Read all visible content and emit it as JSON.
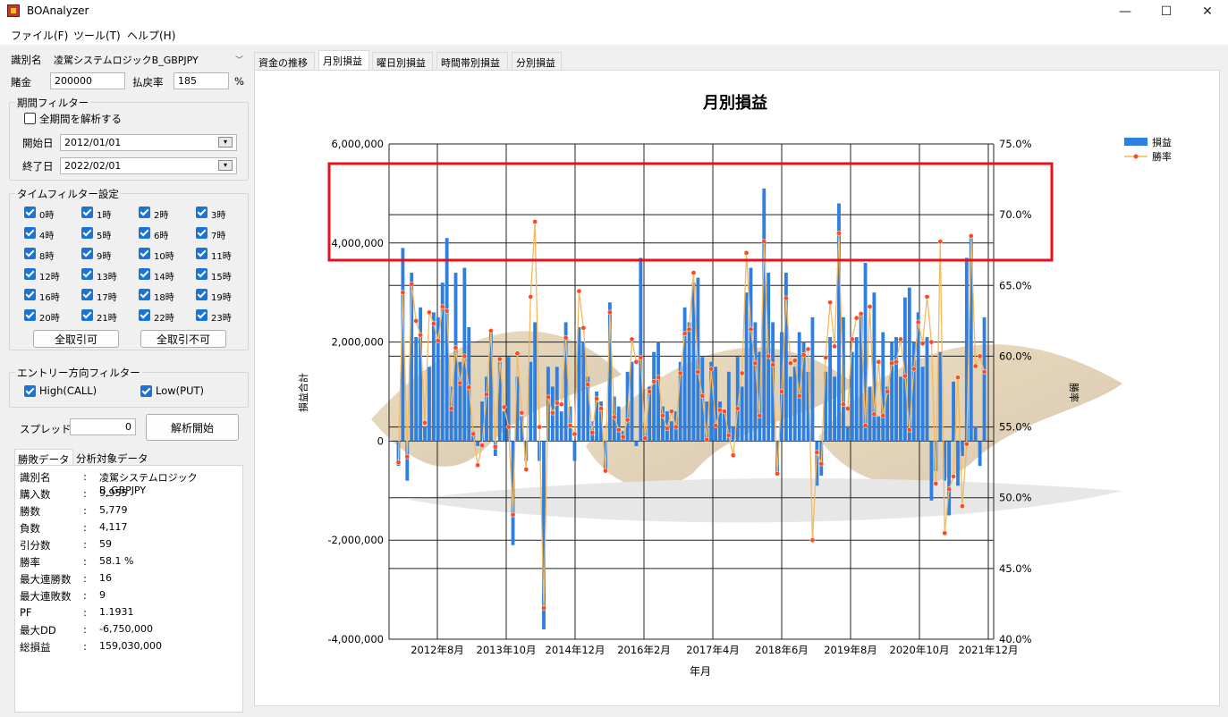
{
  "window": {
    "title": "BOAnalyzer",
    "minimize": "—",
    "maximize": "☐",
    "close": "✕",
    "icon": "app-icon"
  },
  "menu": [
    {
      "label": "ファイル(F)"
    },
    {
      "label": "ツール(T)"
    },
    {
      "label": "ヘルプ(H)"
    }
  ],
  "form": {
    "id_label": "識別名",
    "id_value": "凌駕システムロジックB_GBPJPY",
    "bet_label": "賭金",
    "bet_value": "200000",
    "payout_label": "払戻率",
    "payout_value": "185",
    "payout_unit": "%"
  },
  "period_filter": {
    "title": "期間フィルター",
    "all_period_label": "全期間を解析する",
    "all_period_checked": false,
    "start_label": "開始日",
    "start_value": "2012/01/01",
    "end_label": "終了日",
    "end_value": "2022/02/01"
  },
  "time_filter": {
    "title": "タイムフィルター設定",
    "hours": [
      "0時",
      "1時",
      "2時",
      "3時",
      "4時",
      "5時",
      "6時",
      "7時",
      "8時",
      "9時",
      "10時",
      "11時",
      "12時",
      "13時",
      "14時",
      "15時",
      "16時",
      "17時",
      "18時",
      "19時",
      "20時",
      "21時",
      "22時",
      "23時"
    ],
    "all_on": "全取引可",
    "all_off": "全取引不可"
  },
  "entry_filter": {
    "title": "エントリー方向フィルター",
    "high": "High(CALL)",
    "low": "Low(PUT)"
  },
  "spread": {
    "label": "スプレッド",
    "value": "0"
  },
  "analyze_button": "解析開始",
  "stats_tabs": [
    "勝敗データ",
    "分析対象データ"
  ],
  "stats": [
    {
      "k": "識別名",
      "v": "凌駕システムロジックB_GBPJPY"
    },
    {
      "k": "購入数",
      "v": "9,955"
    },
    {
      "k": "勝数",
      "v": "5,779"
    },
    {
      "k": "負数",
      "v": "4,117"
    },
    {
      "k": "引分数",
      "v": "59"
    },
    {
      "k": "勝率",
      "v": "58.1 %"
    },
    {
      "k": "最大連勝数",
      "v": "16"
    },
    {
      "k": "最大連敗数",
      "v": "9"
    },
    {
      "k": "PF",
      "v": "1.1931"
    },
    {
      "k": "最大DD",
      "v": "-6,750,000"
    },
    {
      "k": "総損益",
      "v": "159,030,000"
    }
  ],
  "stats_colon": ":",
  "tabs": [
    "資金の推移",
    "月別損益",
    "曜日別損益",
    "時間帯別損益",
    "分別損益"
  ],
  "active_tab": 1,
  "chart_data": {
    "type": "bar",
    "title": "月別損益",
    "xlabel": "年月",
    "ylabel": "損益合計",
    "y2label": "勝率",
    "ylim": [
      -4000000,
      6000000
    ],
    "y2lim": [
      40.0,
      75.0
    ],
    "yticks": [
      "6,000,000",
      "4,000,000",
      "2,000,000",
      "0",
      "-2,000,000",
      "-4,000,000"
    ],
    "y2ticks": [
      "75.0%",
      "70.0%",
      "65.0%",
      "60.0%",
      "55.0%",
      "50.0%",
      "45.0%",
      "40.0%"
    ],
    "xticks": [
      "2012年8月",
      "2013年10月",
      "2014年12月",
      "2016年2月",
      "2017年4月",
      "2018年6月",
      "2019年8月",
      "2020年10月",
      "2021年12月"
    ],
    "grid": true,
    "legend": "top-right",
    "colors": {
      "bar": "#2f7fe0",
      "line": "#f5b85b",
      "point": "#ff4a1c",
      "highlight": "#e8101a"
    },
    "series": [
      {
        "name": "損益",
        "axis": "left",
        "values": [
          -500000,
          3900000,
          -800000,
          3400000,
          2100000,
          2700000,
          300000,
          1500000,
          2600000,
          2500000,
          3200000,
          4100000,
          1100000,
          3400000,
          1600000,
          3500000,
          2300000,
          200000,
          -100000,
          800000,
          1300000,
          2200000,
          -300000,
          1600000,
          600000,
          1700000,
          -2100000,
          1300000,
          500000,
          -400000,
          1600000,
          2400000,
          -400000,
          -3800000,
          1500000,
          1100000,
          1500000,
          600000,
          2400000,
          700000,
          -400000,
          2300000,
          2000000,
          1300000,
          400000,
          1000000,
          800000,
          -600000,
          2800000,
          900000,
          700000,
          200000,
          1400000,
          1600000,
          -100000,
          3700000,
          300000,
          1100000,
          1800000,
          2000000,
          700000,
          600000,
          400000,
          600000,
          1600000,
          2700000,
          2400000,
          3200000,
          3300000,
          1700000,
          800000,
          1600000,
          1500000,
          800000,
          600000,
          1400000,
          300000,
          1700000,
          1100000,
          3000000,
          3500000,
          2400000,
          1800000,
          5100000,
          3400000,
          2400000,
          -700000,
          2200000,
          3400000,
          1300000,
          1500000,
          2200000,
          2000000,
          1400000,
          2500000,
          -900000,
          -700000,
          1400000,
          2100000,
          1300000,
          4800000,
          2500000,
          300000,
          1800000,
          2100000,
          2600000,
          3600000,
          1100000,
          3000000,
          500000,
          2200000,
          1100000,
          2000000,
          2100000,
          1300000,
          2900000,
          3100000,
          2000000,
          2600000,
          1500000,
          2100000,
          -1200000,
          -600000,
          1800000,
          -800000,
          -1500000,
          1200000,
          -900000,
          -300000,
          3700000,
          4100000,
          300000,
          -500000,
          2500000
        ]
      },
      {
        "name": "勝率",
        "axis": "right",
        "values": [
          52.5,
          64.5,
          52.9,
          65.1,
          62.5,
          61.5,
          55.3,
          63.1,
          62.3,
          61.1,
          63.5,
          63.2,
          56.3,
          60.6,
          58.1,
          60.0,
          57.8,
          54.5,
          52.3,
          53.7,
          57.3,
          61.8,
          53.6,
          59.8,
          56.4,
          55.0,
          48.8,
          60.2,
          56.0,
          52.0,
          64.2,
          69.5,
          55.0,
          42.2,
          57.1,
          56.0,
          56.7,
          56.6,
          61.3,
          55.1,
          54.5,
          64.6,
          62.0,
          58.0,
          54.6,
          57.0,
          56.3,
          51.9,
          63.1,
          55.7,
          54.8,
          54.3,
          55.5,
          61.2,
          59.6,
          59.9,
          54.2,
          57.5,
          58.2,
          58.5,
          55.8,
          54.9,
          56.1,
          55.0,
          58.8,
          61.6,
          61.9,
          65.9,
          58.9,
          57.2,
          54.1,
          59.1,
          55.1,
          56.2,
          56.1,
          54.4,
          53.0,
          56.3,
          58.8,
          67.3,
          61.9,
          59.5,
          55.8,
          68.1,
          60.0,
          59.4,
          51.7,
          57.5,
          64.1,
          59.5,
          59.7,
          57.2,
          60.1,
          60.5,
          47.0,
          53.2,
          52.4,
          59.9,
          63.8,
          60.7,
          68.7,
          56.6,
          56.3,
          61.2,
          62.7,
          63.0,
          55.1,
          63.5,
          55.9,
          59.6,
          55.8,
          57.5,
          59.5,
          59.6,
          61.2,
          58.6,
          54.8,
          59.1,
          62.4,
          60.9,
          64.2,
          61.0,
          51.0,
          68.1,
          47.5,
          50.6,
          51.5,
          58.5,
          49.4,
          53.8,
          68.5,
          59.3,
          60.0,
          58.9,
          66.5
        ]
      }
    ]
  }
}
